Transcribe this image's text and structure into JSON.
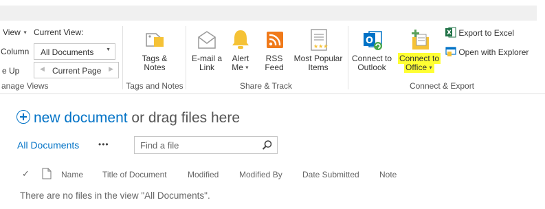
{
  "ribbon": {
    "view_label": "View",
    "current_view_label": "Current View:",
    "column_label": "Column",
    "current_view_value": "All Documents",
    "e_up_label": "e Up",
    "current_page_label": "Current Page",
    "manage_views_group": "anage Views",
    "tags_notes_btn": [
      "Tags &",
      "Notes"
    ],
    "tags_notes_group": "Tags and Notes",
    "email_link_btn": [
      "E-mail a",
      "Link"
    ],
    "alert_me_btn": [
      "Alert",
      "Me"
    ],
    "rss_feed_btn": [
      "RSS",
      "Feed"
    ],
    "most_popular_btn": [
      "Most Popular",
      "Items"
    ],
    "share_track_group": "Share & Track",
    "connect_outlook_btn": [
      "Connect to",
      "Outlook"
    ],
    "connect_office_btn": [
      "Connect to",
      "Office"
    ],
    "export_excel": "Export to Excel",
    "open_explorer": "Open with Explorer",
    "connect_export_group": "Connect & Export"
  },
  "main": {
    "new_document_link": "new document",
    "drag_text": " or drag files here",
    "all_documents_tab": "All Documents",
    "more_ellipsis": "•••",
    "search_placeholder": "Find a file",
    "columns": [
      "Name",
      "Title of Document",
      "Modified",
      "Modified By",
      "Date Submitted",
      "Note"
    ],
    "empty_message": "There are no files in the view \"All Documents\"."
  },
  "colors": {
    "accent": "#0072c6",
    "highlight": "#ffff33",
    "excel_green": "#1e7145",
    "rss_orange": "#f07a1a",
    "alert_yellow": "#f5c236",
    "outlook_blue": "#0072c6"
  }
}
